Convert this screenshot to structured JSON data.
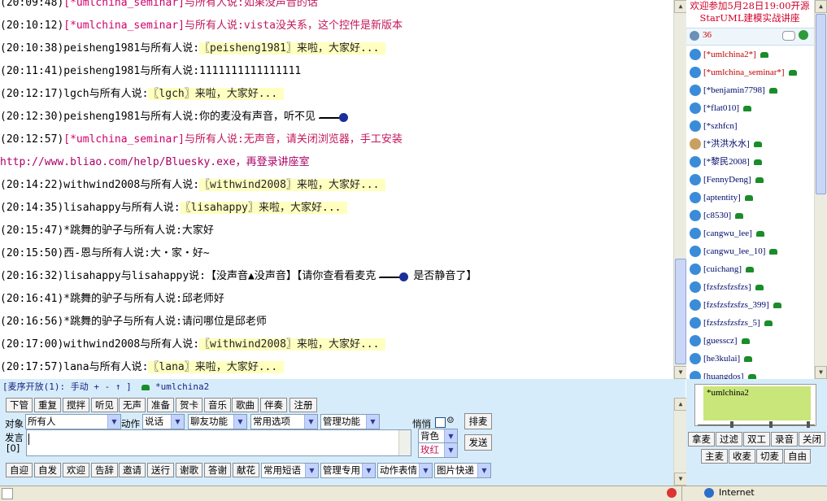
{
  "chat": {
    "lines": [
      {
        "time": "(20:09:48)",
        "who": "[*umlchina_seminar]",
        "rest": "与所有人说:如果没声音的话",
        "style": "red"
      },
      {
        "time": "(20:10:12)",
        "who": "[*umlchina_seminar]",
        "rest": "与所有人说:vista没关系，这个控件是新版本",
        "style": "red"
      },
      {
        "time": "(20:10:38)",
        "who": "peisheng1981",
        "rest": "与所有人说:",
        "hl": "〖peisheng1981〗来啦，大家好..."
      },
      {
        "time": "(20:11:41)",
        "who": "peisheng1981",
        "rest": "与所有人说:1111111111111111"
      },
      {
        "time": "(20:12:17)",
        "who": "lgch",
        "rest": "与所有人说:",
        "hl": "〖lgch〗来啦，大家好..."
      },
      {
        "time": "(20:12:30)",
        "who": "peisheng1981",
        "rest": "与所有人说:你的麦没有声音，听不见",
        "mic": true
      },
      {
        "time": "(20:12:57)",
        "who": "[*umlchina_seminar]",
        "rest": "与所有人说:无声音，请关闭浏览器，手工安装",
        "style": "red"
      },
      {
        "time": "",
        "who": "",
        "rest": "http://www.bliao.com/help/Bluesky.exe，再登录讲座室",
        "style": "link"
      },
      {
        "time": "(20:14:22)",
        "who": "withwind2008",
        "rest": "与所有人说:",
        "hl": "〖withwind2008〗来啦，大家好..."
      },
      {
        "time": "(20:14:35)",
        "who": "lisahappy",
        "rest": "与所有人说:",
        "hl": "〖lisahappy〗来啦，大家好..."
      },
      {
        "time": "(20:15:47)",
        "who": "*跳舞的驴子",
        "rest": "与所有人说:大家好"
      },
      {
        "time": "(20:15:50)",
        "who": "西-恩",
        "rest": "与所有人说:大・家・好~"
      },
      {
        "time": "(20:16:32)",
        "who": "lisahappy",
        "rest": "与lisahappy说:【没声音▲没声音】【请你查看看麦克",
        "mic2": true,
        "tail": "是否静音了】"
      },
      {
        "time": "(20:16:41)",
        "who": "*跳舞的驴子",
        "rest": "与所有人说:邱老师好"
      },
      {
        "time": "(20:16:56)",
        "who": "*跳舞的驴子",
        "rest": "与所有人说:请问哪位是邱老师"
      },
      {
        "time": "(20:17:00)",
        "who": "withwind2008",
        "rest": "与所有人说:",
        "hl": "〖withwind2008〗来啦，大家好..."
      },
      {
        "time": "(20:17:57)",
        "who": "lana",
        "rest": "与所有人说:",
        "hl": "〖lana〗来啦，大家好..."
      }
    ]
  },
  "sidebar": {
    "welcome_line1": "欢迎参加5月28日19:00开源",
    "welcome_line2": "StarUML建模实战讲座",
    "user_count": "36",
    "users": [
      "[*umlchina2*]",
      "[*umlchina_seminar*]",
      "[*benjamin7798]",
      "[*flat010]",
      "[*szhfcn]",
      "[*洪洪水水]",
      "[*黎民2008]",
      "[FennyDeng]",
      "[aptentity]",
      "[c8530]",
      "[cangwu_lee]",
      "[cangwu_lee_10]",
      "[cuichang]",
      "[fzsfzsfzsfzs]",
      "[fzsfzsfzsfzs_399]",
      "[fzsfzsfzsfzs_5]",
      "[guesscz]",
      "[he3kulai]",
      "[huangdos]"
    ]
  },
  "mic_status": {
    "text": "[麦序开放(1): 手动 + - ↑ ]",
    "user": "*umlchina2"
  },
  "toolbar_row1": [
    "下管",
    "重复",
    "搅拌",
    "听见",
    "无声",
    "准备",
    "贺卡",
    "音乐",
    "歌曲",
    "伴奏",
    "注册"
  ],
  "controls": {
    "target_label": "对象",
    "target_value": "所有人",
    "action_label": "动作",
    "action_value": "说话",
    "chat_func": "聊友功能",
    "common_opts": "常用选项",
    "manage_func": "管理功能",
    "private_label": "悄悄",
    "queue_btn": "排麦",
    "speak_label": "发言",
    "speak_count": "[0]",
    "bg_color": "背色",
    "fg_color": "玫红",
    "send_btn": "发送"
  },
  "toolbar_row3": [
    "自迎",
    "自发",
    "欢迎",
    "告辞",
    "邀请",
    "送行",
    "谢歌",
    "答谢",
    "献花"
  ],
  "toolbar_row3_selects": [
    "常用短语",
    "管理专用",
    "动作表情",
    "图片快递"
  ],
  "right_bottom": {
    "queue_user": "*umlchina2",
    "row1": [
      "拿麦",
      "过滤",
      "双工",
      "录音",
      "关闭"
    ],
    "row2": [
      "主麦",
      "收麦",
      "切麦",
      "自由"
    ]
  },
  "statusbar": {
    "zone": "Internet"
  }
}
